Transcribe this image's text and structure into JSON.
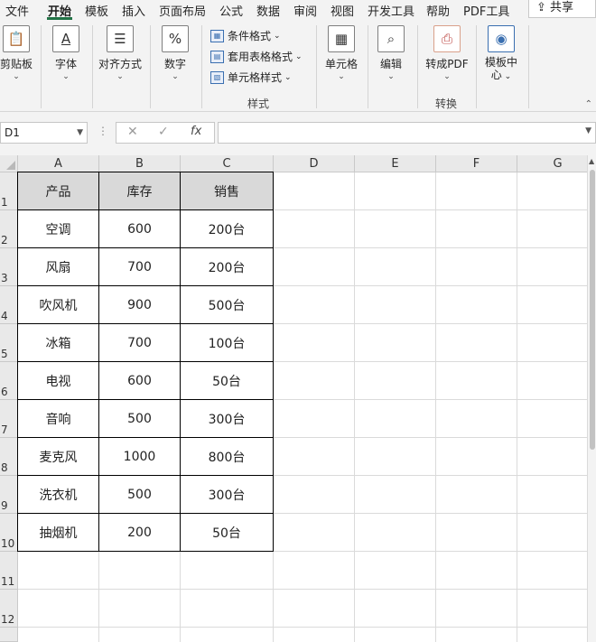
{
  "menu": {
    "items": [
      "文件",
      "开始",
      "模板",
      "插入",
      "页面布局",
      "公式",
      "数据",
      "审阅",
      "视图",
      "开发工具",
      "帮助",
      "PDF工具"
    ],
    "active_index": 1,
    "share_label": "共享"
  },
  "ribbon": {
    "clipboard_label": "剪贴板",
    "font_label": "字体",
    "align_label": "对齐方式",
    "number_label": "数字",
    "conditional_format_label": "条件格式",
    "table_format_label": "套用表格格式",
    "cell_style_label": "单元格样式",
    "styles_group_label": "样式",
    "cells_label": "单元格",
    "edit_label": "编辑",
    "to_pdf_label": "转成PDF",
    "convert_group_label": "转换",
    "template_center_label_1": "模板中",
    "template_center_label_2": "心"
  },
  "formula_bar": {
    "name_box": "D1",
    "formula": "",
    "fx_label": "fx"
  },
  "sheet": {
    "columns": [
      "A",
      "B",
      "C",
      "D",
      "E",
      "F",
      "G"
    ],
    "rows": [
      "1",
      "2",
      "3",
      "4",
      "5",
      "6",
      "7",
      "8",
      "9",
      "10",
      "11",
      "12"
    ],
    "table_header": [
      "产品",
      "库存",
      "销售"
    ],
    "table_rows": [
      [
        "空调",
        "600",
        "200台"
      ],
      [
        "风扇",
        "700",
        "200台"
      ],
      [
        "吹风机",
        "900",
        "500台"
      ],
      [
        "冰箱",
        "700",
        "100台"
      ],
      [
        "电视",
        "600",
        "50台"
      ],
      [
        "音响",
        "500",
        "300台"
      ],
      [
        "麦克风",
        "1000",
        "800台"
      ],
      [
        "洗衣机",
        "500",
        "300台"
      ],
      [
        "抽烟机",
        "200",
        "50台"
      ]
    ]
  },
  "colors": {
    "accent": "#217346",
    "header_fill": "#d9d9d9",
    "ribbon_bg": "#f3f3f3"
  }
}
